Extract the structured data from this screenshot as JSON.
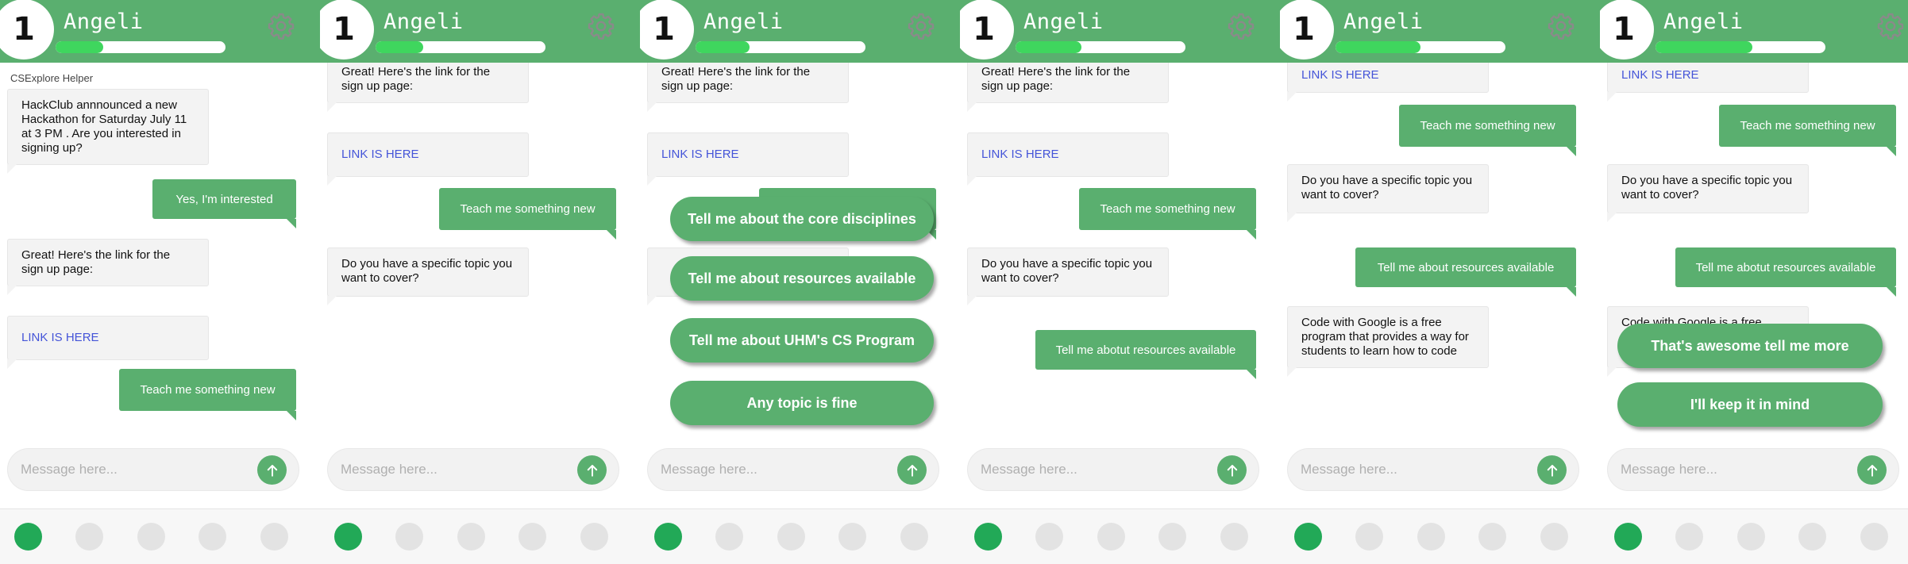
{
  "app": {
    "level": "1",
    "user_name": "Angeli",
    "helper_label": "CSExplore Helper",
    "input_placeholder": "Message here...",
    "progress_fractions": [
      0.28,
      0.28,
      0.32,
      0.39,
      0.5,
      0.57
    ]
  },
  "icons": {
    "settings": "gear-icon",
    "send": "arrow-up-icon"
  },
  "colors": {
    "accent": "#5aaf6f",
    "progress": "#3fd65e",
    "link": "#4454d8",
    "active_dot": "#22a957"
  },
  "messages": {
    "hackathon": "HackClub annnounced a new Hackathon for Saturday July 11 at 3 PM . Are you interested in signing up?",
    "interested": "Yes, I'm interested",
    "signup": "Great! Here's the link for the sign up page:",
    "link": "LINK IS HERE",
    "teach": "Teach me something new",
    "topic": "Do you have a specific topic you want to cover?",
    "resources": "Tell me about resources available",
    "resources_typo": "Tell me abotut resources available",
    "codewithgoogle": "Code with Google is a free program that provides a way for students to learn how to code"
  },
  "options": {
    "core": "Tell me about the core disciplines",
    "resources": "Tell me about resources available",
    "uhm": "Tell me about UHM's CS Program",
    "any": "Any topic is fine",
    "awesome": "That's awesome tell me more",
    "keep": "I'll keep it in mind"
  },
  "pagination": {
    "count": 5,
    "active_index": 0
  }
}
